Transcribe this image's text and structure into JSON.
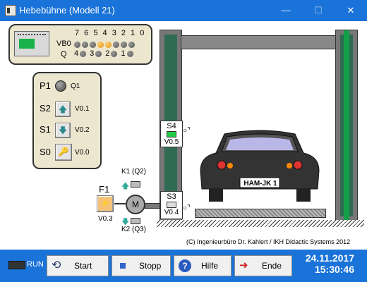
{
  "window": {
    "title": "Hebebühne (Modell 21)",
    "minimize": "—",
    "maximize": "☐",
    "close": "✕"
  },
  "plc": {
    "bit_header": "7 6 5 4 3 2 1 0",
    "vb0_label": "VB0",
    "q_label": "Q",
    "vb0_leds": [
      false,
      false,
      false,
      true,
      true,
      false,
      false,
      false
    ],
    "q_row": [
      {
        "num": "4",
        "on": false
      },
      {
        "num": "3",
        "on": false
      },
      {
        "num": "2",
        "on": false
      },
      {
        "num": "1",
        "on": false
      }
    ]
  },
  "controls": {
    "p1": {
      "label": "P1",
      "addr": "Q1"
    },
    "s2": {
      "label": "S2",
      "addr": "V0.1",
      "icon": "arrow-up-icon"
    },
    "s1": {
      "label": "S1",
      "addr": "V0.2",
      "icon": "arrow-down-icon"
    },
    "s0": {
      "label": "S0",
      "addr": "V0.0",
      "icon": "key-icon"
    }
  },
  "motor": {
    "f1_label": "F1",
    "f1_addr": "V0.3",
    "motor_label": "M",
    "k1_label": "K1 (Q2)",
    "k2_label": "K2 (Q3)"
  },
  "sensors": {
    "s4": {
      "label": "S4",
      "addr": "V0.5",
      "state_color": "#22cc44"
    },
    "s3": {
      "label": "S3",
      "addr": "V0.4",
      "state_color": "#dddddd"
    }
  },
  "car": {
    "plate": "HAM-JK 1"
  },
  "copyright": "(C) Ingenieurbüro Dr. Kahlert / IKH Didactic Systems 2012",
  "statusbar": {
    "run_label": "RUN",
    "start_label": "Start",
    "stop_label": "Stopp",
    "help_label": "Hilfe",
    "exit_label": "Ende",
    "date": "24.11.2017",
    "time": "15:30:46"
  }
}
